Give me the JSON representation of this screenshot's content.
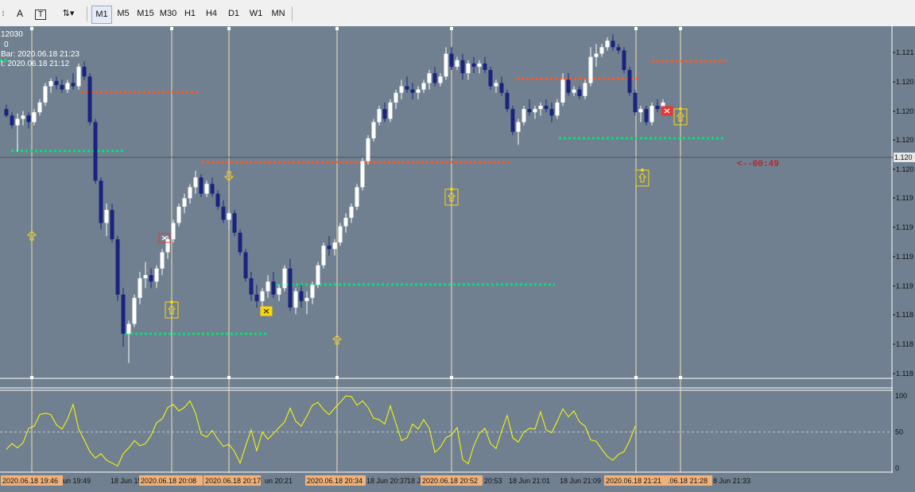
{
  "toolbar": {
    "left_icons": [
      "menu-f-icon",
      "text-a-icon",
      "text-t-icon",
      "arrows-icon"
    ],
    "timeframes": [
      "M1",
      "M5",
      "M15",
      "M30",
      "H1",
      "H4",
      "D1",
      "W1",
      "MN"
    ],
    "active_timeframe": "M1"
  },
  "info_overlay": {
    "line1": "12030",
    "line2": "0",
    "line3": "Bar: 2020.06.18 21:23",
    "line4": "t: 2020.06.18 21:12"
  },
  "countdown": "<--00:49",
  "price_axis": {
    "labels": [
      "1.121",
      "1.120",
      "1.120",
      "1.120",
      "1.120",
      "1.119",
      "1.119",
      "1.119",
      "1.119",
      "1.118",
      "1.118",
      "1.118"
    ],
    "current_price_label": "1.120"
  },
  "oscillator_axis": {
    "labels": [
      "100",
      "50",
      "0"
    ]
  },
  "time_axis": {
    "labels": [
      {
        "text": "2020.06.18 19:46",
        "highlight": true
      },
      {
        "text": "un 19:49",
        "highlight": false
      },
      {
        "text": "18 Jun 19:5",
        "highlight": false
      },
      {
        "text": "2020.06.18 20:08",
        "highlight": true
      },
      {
        "text": "2020.06.18 20:17",
        "highlight": true
      },
      {
        "text": "un 20:21",
        "highlight": false
      },
      {
        "text": "2020.06.18 20:34",
        "highlight": true
      },
      {
        "text": "18 Jun 20:37",
        "highlight": false
      },
      {
        "text": "18 J",
        "highlight": false
      },
      {
        "text": "2020.06.18 20:52",
        "highlight": true
      },
      {
        "text": "20:53",
        "highlight": false
      },
      {
        "text": "18 Jun 21:01",
        "highlight": false
      },
      {
        "text": "18 Jun 21:09",
        "highlight": false
      },
      {
        "text": "2020.06.18 21:21",
        "highlight": true
      },
      {
        "text": ".06.18 21:28",
        "highlight": true
      },
      {
        "text": "8 Jun 21:33",
        "highlight": false
      }
    ]
  },
  "colors": {
    "background": "#708090",
    "bull_candle": "#ffffff",
    "bear_candle": "#1a237e",
    "resistance_dots": "#ff5722",
    "support_dots": "#00e676",
    "vertical_lines": "#f5deb3",
    "oscillator_line": "#ffff00",
    "signal_marker": "#ffd700",
    "exit_marker": "#e53935",
    "countdown": "#d50000",
    "time_highlight": "#f0b27a"
  },
  "candles": [
    [
      1.12015,
      1.12022,
      1.12002,
      1.12005
    ],
    [
      1.12005,
      1.1201,
      1.11985,
      1.1199
    ],
    [
      1.1199,
      1.12008,
      1.1195,
      1.12
    ],
    [
      1.12,
      1.12012,
      1.1199,
      1.12005
    ],
    [
      1.12005,
      1.1201,
      1.11985,
      1.11995
    ],
    [
      1.11995,
      1.12015,
      1.1199,
      1.1201
    ],
    [
      1.1201,
      1.1203,
      1.12005,
      1.12025
    ],
    [
      1.12025,
      1.12055,
      1.1202,
      1.1205
    ],
    [
      1.1205,
      1.12062,
      1.1204,
      1.12058
    ],
    [
      1.12058,
      1.12065,
      1.12045,
      1.12052
    ],
    [
      1.12052,
      1.1206,
      1.1204,
      1.12045
    ],
    [
      1.12045,
      1.1206,
      1.1204,
      1.12055
    ],
    [
      1.12055,
      1.1207,
      1.12045,
      1.1205
    ],
    [
      1.1205,
      1.12085,
      1.12045,
      1.1208
    ],
    [
      1.1208,
      1.12088,
      1.1206,
      1.12065
    ],
    [
      1.12065,
      1.1207,
      1.1199,
      1.11995
    ],
    [
      1.11995,
      1.12,
      1.119,
      1.11905
    ],
    [
      1.11905,
      1.1191,
      1.1183,
      1.1184
    ],
    [
      1.1184,
      1.1187,
      1.1182,
      1.1186
    ],
    [
      1.1186,
      1.1187,
      1.1181,
      1.11815
    ],
    [
      1.11815,
      1.1182,
      1.1172,
      1.1173
    ],
    [
      1.1173,
      1.1174,
      1.1165,
      1.1167
    ],
    [
      1.1167,
      1.1169,
      1.11625,
      1.11685
    ],
    [
      1.11685,
      1.1173,
      1.1168,
      1.11725
    ],
    [
      1.11725,
      1.11765,
      1.11715,
      1.11755
    ],
    [
      1.11755,
      1.1178,
      1.1174,
      1.1176
    ],
    [
      1.1176,
      1.1177,
      1.1174,
      1.1175
    ],
    [
      1.1175,
      1.11775,
      1.1174,
      1.1177
    ],
    [
      1.1177,
      1.118,
      1.1176,
      1.11795
    ],
    [
      1.11795,
      1.1182,
      1.11785,
      1.11815
    ],
    [
      1.11815,
      1.11845,
      1.1181,
      1.1184
    ],
    [
      1.1184,
      1.1187,
      1.11835,
      1.11865
    ],
    [
      1.11865,
      1.11885,
      1.11855,
      1.11878
    ],
    [
      1.11878,
      1.119,
      1.1187,
      1.11895
    ],
    [
      1.11895,
      1.1192,
      1.11885,
      1.1191
    ],
    [
      1.1191,
      1.11915,
      1.1188,
      1.11885
    ],
    [
      1.11885,
      1.11905,
      1.1188,
      1.119
    ],
    [
      1.119,
      1.1191,
      1.1188,
      1.11885
    ],
    [
      1.11885,
      1.1189,
      1.1186,
      1.11865
    ],
    [
      1.11865,
      1.11875,
      1.1184,
      1.11845
    ],
    [
      1.11845,
      1.1186,
      1.1183,
      1.11855
    ],
    [
      1.11855,
      1.1186,
      1.1182,
      1.11825
    ],
    [
      1.11825,
      1.1183,
      1.1179,
      1.11795
    ],
    [
      1.11795,
      1.118,
      1.1175,
      1.11755
    ],
    [
      1.11755,
      1.11765,
      1.1172,
      1.1173
    ],
    [
      1.1173,
      1.11745,
      1.1171,
      1.1172
    ],
    [
      1.1172,
      1.1174,
      1.117,
      1.11735
    ],
    [
      1.11735,
      1.1176,
      1.11725,
      1.1175
    ],
    [
      1.1175,
      1.11765,
      1.11725,
      1.1173
    ],
    [
      1.1173,
      1.11745,
      1.1172,
      1.1174
    ],
    [
      1.1174,
      1.11775,
      1.11735,
      1.1177
    ],
    [
      1.1177,
      1.11785,
      1.11705,
      1.1171
    ],
    [
      1.1171,
      1.1174,
      1.117,
      1.11735
    ],
    [
      1.11735,
      1.11745,
      1.1171,
      1.1172
    ],
    [
      1.1172,
      1.11735,
      1.117,
      1.11725
    ],
    [
      1.11725,
      1.1175,
      1.11715,
      1.11745
    ],
    [
      1.11745,
      1.1178,
      1.1174,
      1.11775
    ],
    [
      1.11775,
      1.1181,
      1.1177,
      1.11805
    ],
    [
      1.11805,
      1.1182,
      1.1179,
      1.118
    ],
    [
      1.118,
      1.11815,
      1.1179,
      1.1181
    ],
    [
      1.1181,
      1.1184,
      1.11805,
      1.11835
    ],
    [
      1.11835,
      1.11855,
      1.11825,
      1.11848
    ],
    [
      1.11848,
      1.1187,
      1.1184,
      1.11865
    ],
    [
      1.11865,
      1.119,
      1.1186,
      1.11895
    ],
    [
      1.11895,
      1.1194,
      1.1189,
      1.11935
    ],
    [
      1.11935,
      1.11975,
      1.1193,
      1.1197
    ],
    [
      1.1197,
      1.12,
      1.11965,
      1.11995
    ],
    [
      1.11995,
      1.1202,
      1.1199,
      1.12015
    ],
    [
      1.12015,
      1.12025,
      1.11995,
      1.12
    ],
    [
      1.12,
      1.1203,
      1.11995,
      1.12025
    ],
    [
      1.12025,
      1.12045,
      1.12015,
      1.1204
    ],
    [
      1.1204,
      1.1206,
      1.1203,
      1.1205
    ],
    [
      1.1205,
      1.12065,
      1.1204,
      1.12045
    ],
    [
      1.12045,
      1.12055,
      1.1203,
      1.1204
    ],
    [
      1.1204,
      1.1205,
      1.1203,
      1.12045
    ],
    [
      1.12045,
      1.1206,
      1.1204,
      1.12055
    ],
    [
      1.12055,
      1.12075,
      1.12045,
      1.1207
    ],
    [
      1.1207,
      1.1208,
      1.1205,
      1.12055
    ],
    [
      1.12055,
      1.1207,
      1.1205,
      1.12065
    ],
    [
      1.12065,
      1.1211,
      1.1206,
      1.121
    ],
    [
      1.121,
      1.1211,
      1.12075,
      1.1208
    ],
    [
      1.1208,
      1.12095,
      1.12075,
      1.1209
    ],
    [
      1.1209,
      1.121,
      1.1206,
      1.1207
    ],
    [
      1.1207,
      1.1209,
      1.1206,
      1.12085
    ],
    [
      1.12085,
      1.12095,
      1.1207,
      1.1208
    ],
    [
      1.1208,
      1.1209,
      1.1207,
      1.12085
    ],
    [
      1.12085,
      1.12095,
      1.1207,
      1.12075
    ],
    [
      1.12075,
      1.1208,
      1.12045,
      1.1205
    ],
    [
      1.1205,
      1.1206,
      1.1204,
      1.12055
    ],
    [
      1.12055,
      1.12065,
      1.12035,
      1.1204
    ],
    [
      1.1204,
      1.12045,
      1.1201,
      1.12015
    ],
    [
      1.12015,
      1.1202,
      1.11975,
      1.1198
    ],
    [
      1.1198,
      1.12,
      1.1196,
      1.11995
    ],
    [
      1.11995,
      1.1202,
      1.1199,
      1.12015
    ],
    [
      1.12015,
      1.1203,
      1.12005,
      1.1201
    ],
    [
      1.1201,
      1.1202,
      1.12,
      1.12015
    ],
    [
      1.12015,
      1.12025,
      1.12005,
      1.1202
    ],
    [
      1.1202,
      1.1203,
      1.1201,
      1.12015
    ],
    [
      1.12015,
      1.12025,
      1.11995,
      1.12005
    ],
    [
      1.12005,
      1.1203,
      1.12,
      1.12025
    ],
    [
      1.12025,
      1.1207,
      1.1202,
      1.1206
    ],
    [
      1.1206,
      1.1207,
      1.12035,
      1.1204
    ],
    [
      1.1204,
      1.1205,
      1.12035,
      1.12045
    ],
    [
      1.12045,
      1.1205,
      1.1203,
      1.12035
    ],
    [
      1.12035,
      1.1206,
      1.1203,
      1.12055
    ],
    [
      1.12055,
      1.1211,
      1.1205,
      1.12095
    ],
    [
      1.12095,
      1.12115,
      1.1208,
      1.121
    ],
    [
      1.121,
      1.12115,
      1.12095,
      1.1211
    ],
    [
      1.1211,
      1.12125,
      1.12105,
      1.1212
    ],
    [
      1.1212,
      1.1213,
      1.12105,
      1.1211
    ],
    [
      1.1211,
      1.12115,
      1.121,
      1.12105
    ],
    [
      1.12105,
      1.1211,
      1.1207,
      1.12075
    ],
    [
      1.12075,
      1.1208,
      1.12035,
      1.1204
    ],
    [
      1.1204,
      1.12045,
      1.12005,
      1.1201
    ],
    [
      1.1201,
      1.1202,
      1.11995,
      1.12015
    ],
    [
      1.12015,
      1.1202,
      1.1199,
      1.11995
    ],
    [
      1.11995,
      1.12025,
      1.1199,
      1.1202
    ],
    [
      1.1202,
      1.1203,
      1.1201,
      1.12015
    ],
    [
      1.12015,
      1.1203,
      1.1201,
      1.12025
    ]
  ],
  "oscillator": [
    26,
    34,
    28,
    35,
    55,
    58,
    74,
    76,
    74,
    60,
    54,
    68,
    88,
    54,
    39,
    23,
    14,
    20,
    11,
    7,
    3,
    20,
    28,
    38,
    31,
    34,
    45,
    63,
    68,
    84,
    88,
    79,
    84,
    93,
    76,
    47,
    43,
    52,
    40,
    30,
    33,
    23,
    7,
    31,
    53,
    24,
    50,
    40,
    48,
    56,
    64,
    83,
    65,
    58,
    72,
    87,
    91,
    81,
    74,
    83,
    91,
    100,
    99,
    87,
    93,
    84,
    69,
    67,
    61,
    86,
    62,
    38,
    42,
    61,
    54,
    67,
    55,
    22,
    29,
    42,
    46,
    56,
    12,
    6,
    31,
    48,
    55,
    34,
    27,
    51,
    73,
    42,
    36,
    50,
    55,
    54,
    78,
    53,
    49,
    65,
    82,
    71,
    79,
    64,
    58,
    39,
    37,
    26,
    16,
    11,
    19,
    23,
    38,
    58
  ]
}
